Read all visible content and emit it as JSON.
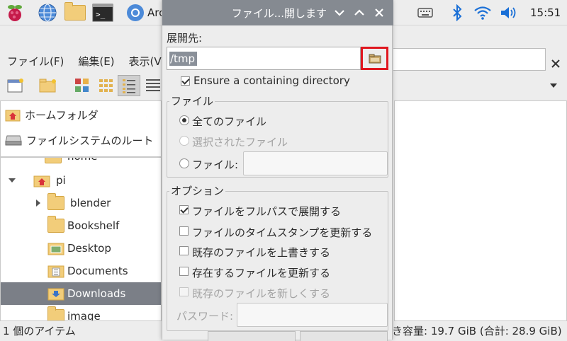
{
  "panel": {
    "app_title": "Arc",
    "clock": "15:51"
  },
  "file_manager": {
    "menu": [
      "ファイル(F)",
      "編集(E)",
      "表示(V)"
    ],
    "places": [
      {
        "label": "ホームフォルダ",
        "icon": "home-icon"
      },
      {
        "label": "ファイルシステムのルート",
        "icon": "drive-icon"
      }
    ],
    "tree": [
      {
        "label": "home",
        "icon": "folder-icon"
      },
      {
        "label": "pi",
        "icon": "home-folder-icon",
        "expanded": true
      },
      {
        "label": "blender",
        "icon": "folder-icon",
        "collapsed_arrow": true
      },
      {
        "label": "Bookshelf",
        "icon": "folder-icon"
      },
      {
        "label": "Desktop",
        "icon": "desktop-folder-icon"
      },
      {
        "label": "Documents",
        "icon": "documents-folder-icon"
      },
      {
        "label": "Downloads",
        "icon": "downloads-folder-icon",
        "selected": true
      },
      {
        "label": "image",
        "icon": "folder-icon"
      }
    ],
    "status_left": "1 個のアイテム",
    "status_right": "き容量: 19.7 GiB (合計: 28.9 GiB)"
  },
  "dialog": {
    "title": "ファイル...開します",
    "dest_label": "展開先:",
    "dest_value": "/tmp",
    "ensure_dir_label": "Ensure a containing directory",
    "ensure_dir_checked": true,
    "files_group": {
      "title": "ファイル",
      "all_files": "全てのファイル",
      "selected_files": "選択されたファイル",
      "files": "ファイル:",
      "selection": "all"
    },
    "options_group": {
      "title": "オプション",
      "full_path": "ファイルをフルパスで展開する",
      "full_path_checked": true,
      "update_timestamp": "ファイルのタイムスタンプを更新する",
      "overwrite": "既存のファイルを上書きする",
      "update_existing": "存在するファイルを更新する",
      "newer_only": "既存のファイルを新しくする",
      "password_label": "パスワード:"
    },
    "highlight_color": "#e0171f"
  }
}
